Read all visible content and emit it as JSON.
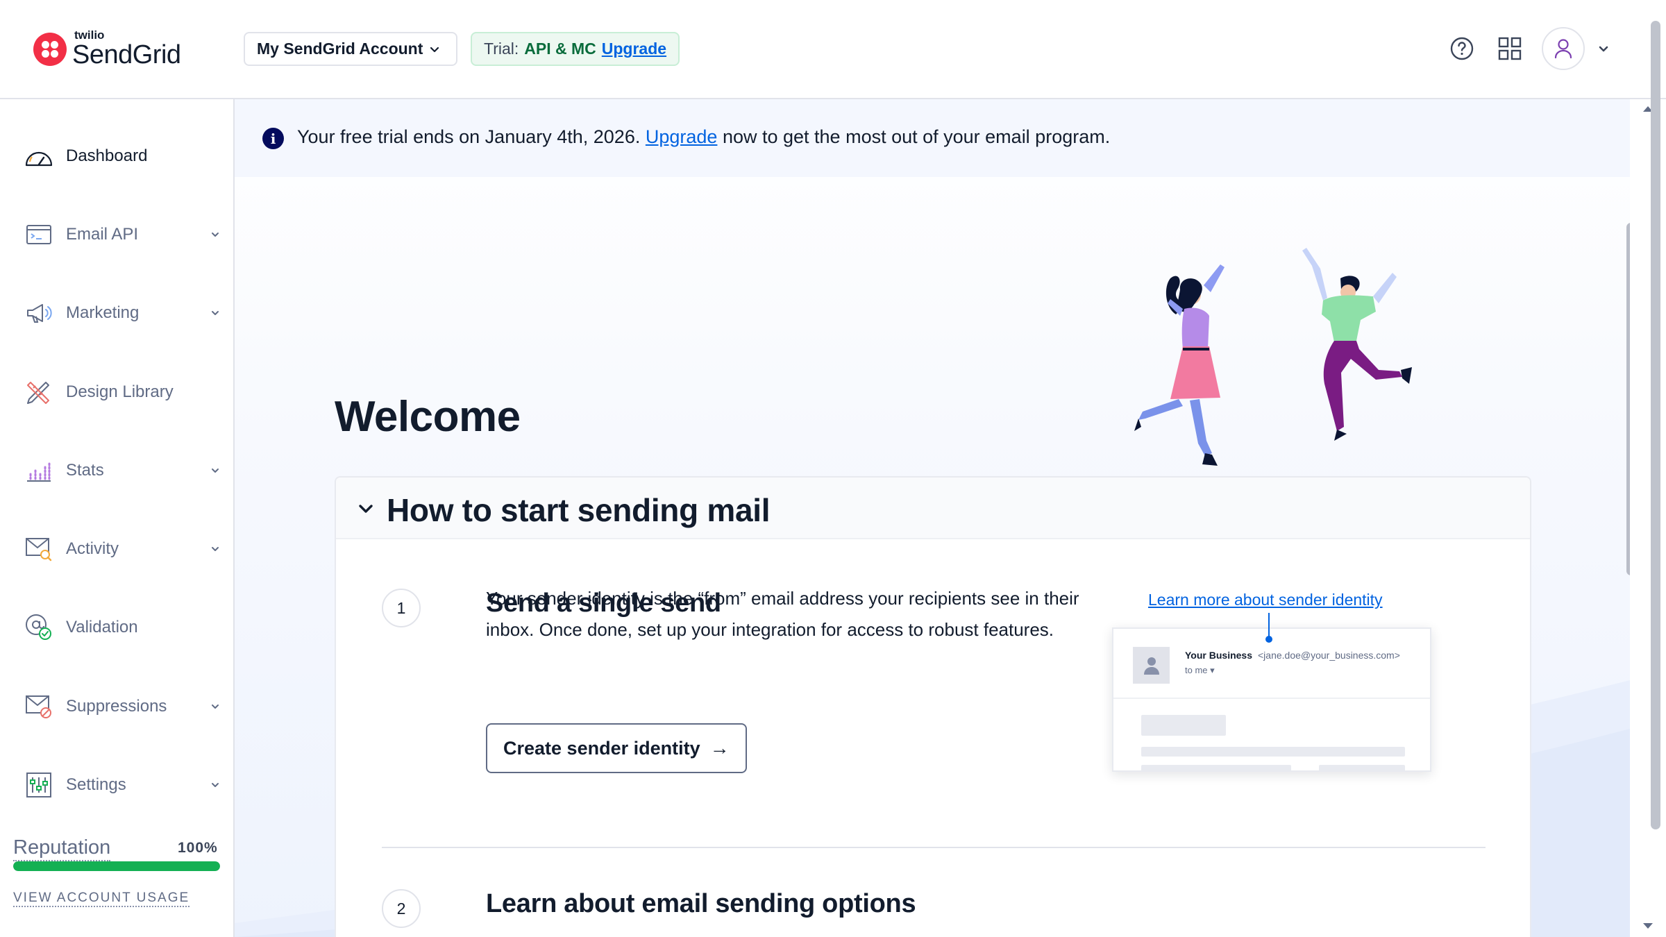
{
  "header": {
    "logo_small": "twilio",
    "logo_big": "SendGrid",
    "account_select": "My SendGrid Account",
    "trial_label": "Trial:",
    "trial_plan": "API & MC",
    "trial_upgrade": "Upgrade",
    "icons": [
      "help-icon",
      "apps-grid-icon",
      "user-icon"
    ]
  },
  "sidebar": {
    "items": [
      {
        "label": "Dashboard",
        "icon": "dashboard-gauge-icon",
        "expandable": false,
        "active": true
      },
      {
        "label": "Email API",
        "icon": "terminal-window-icon",
        "expandable": true
      },
      {
        "label": "Marketing",
        "icon": "megaphone-icon",
        "expandable": true
      },
      {
        "label": "Design Library",
        "icon": "pencil-ruler-icon",
        "expandable": false
      },
      {
        "label": "Stats",
        "icon": "bar-chart-icon",
        "expandable": true
      },
      {
        "label": "Activity",
        "icon": "mail-search-icon",
        "expandable": true
      },
      {
        "label": "Validation",
        "icon": "at-check-icon",
        "expandable": false
      },
      {
        "label": "Suppressions",
        "icon": "mail-block-icon",
        "expandable": true
      },
      {
        "label": "Settings",
        "icon": "sliders-icon",
        "expandable": true
      }
    ],
    "reputation_label": "Reputation",
    "reputation_value": "100%",
    "reputation_fraction": 1.0,
    "usage_link": "VIEW ACCOUNT USAGE"
  },
  "banner": {
    "icon": "info-icon",
    "text_before": "Your free trial ends on January 4th, 2026.",
    "link": "Upgrade",
    "text_after": "now to get the most out of your email program."
  },
  "main": {
    "welcome": "Welcome",
    "section_title": "How to start sending mail",
    "steps": [
      {
        "number": "1",
        "title": "Send a single send",
        "description": "Your sender identity is the “from” email address your recipients see in their inbox. Once done, set up your integration for access to robust features.",
        "button": "Create sender identity",
        "learn_link": "Learn more about sender identity"
      },
      {
        "number": "2",
        "title": "Learn about email sending options"
      }
    ],
    "preview": {
      "from_name": "Your Business",
      "from_addr": "<jane.doe@your_business.com>",
      "to": "to me"
    }
  },
  "colors": {
    "brand_red": "#f22f46",
    "link_blue": "#0263e0",
    "reputation_green": "#14b053",
    "trial_green": "#0a6c3c"
  }
}
